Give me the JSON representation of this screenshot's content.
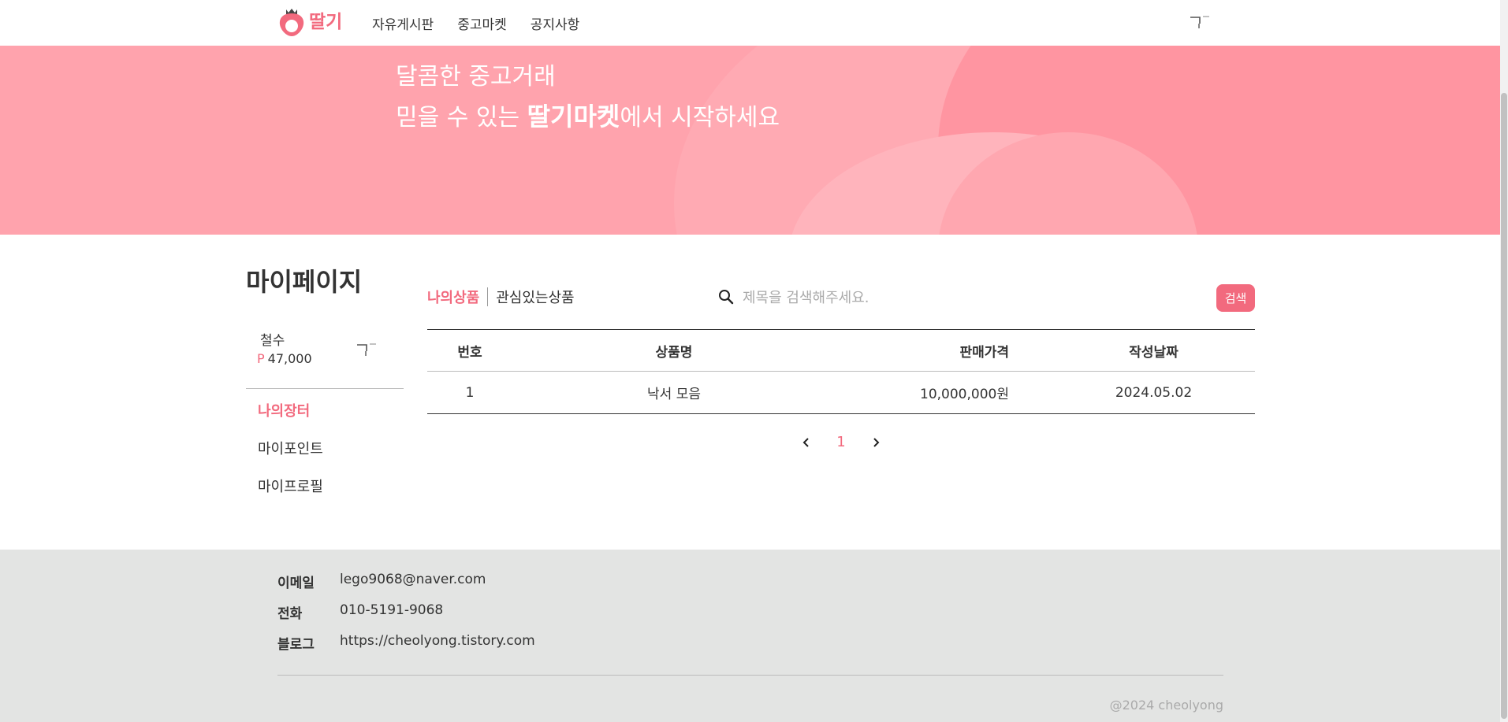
{
  "header": {
    "logo_text": "딸기",
    "nav": [
      "자유게시판",
      "중고마켓",
      "공지사항"
    ]
  },
  "hero": {
    "line1": "달콤한 중고거래",
    "line2_prefix": "믿을 수 있는 ",
    "line2_brand": "딸기마켓",
    "line2_suffix": "에서 시작하세요"
  },
  "sidebar": {
    "title": "마이페이지",
    "user_name": "철수",
    "point_symbol": "P",
    "point_value": "47,000",
    "menu": [
      "나의장터",
      "마이포인트",
      "마이프로필"
    ]
  },
  "main": {
    "tab_active": "나의상품",
    "tab_inactive": "관심있는상품",
    "search_placeholder": "제목을 검색해주세요.",
    "search_button": "검색",
    "table": {
      "headers": [
        "번호",
        "상품명",
        "판매가격",
        "작성날짜"
      ],
      "rows": [
        [
          "1",
          "낙서 모음",
          "10,000,000원",
          "2024.05.02"
        ]
      ]
    },
    "pagination": {
      "current": "1"
    }
  },
  "footer": {
    "email_label": "이메일",
    "email": "lego9068@naver.com",
    "phone_label": "전화",
    "phone": "010-5191-9068",
    "blog_label": "블로그",
    "blog": "https://cheolyong.tistory.com",
    "copyright": "@2024 cheolyong"
  },
  "colors": {
    "accent": "#f26a7e",
    "hero_bg": "#ffa3ad",
    "footer_bg": "#e3e4e3"
  },
  "icons": [
    "strawberry-logo-icon",
    "profile-icon",
    "search-icon",
    "chevron-left-icon",
    "chevron-right-icon"
  ]
}
